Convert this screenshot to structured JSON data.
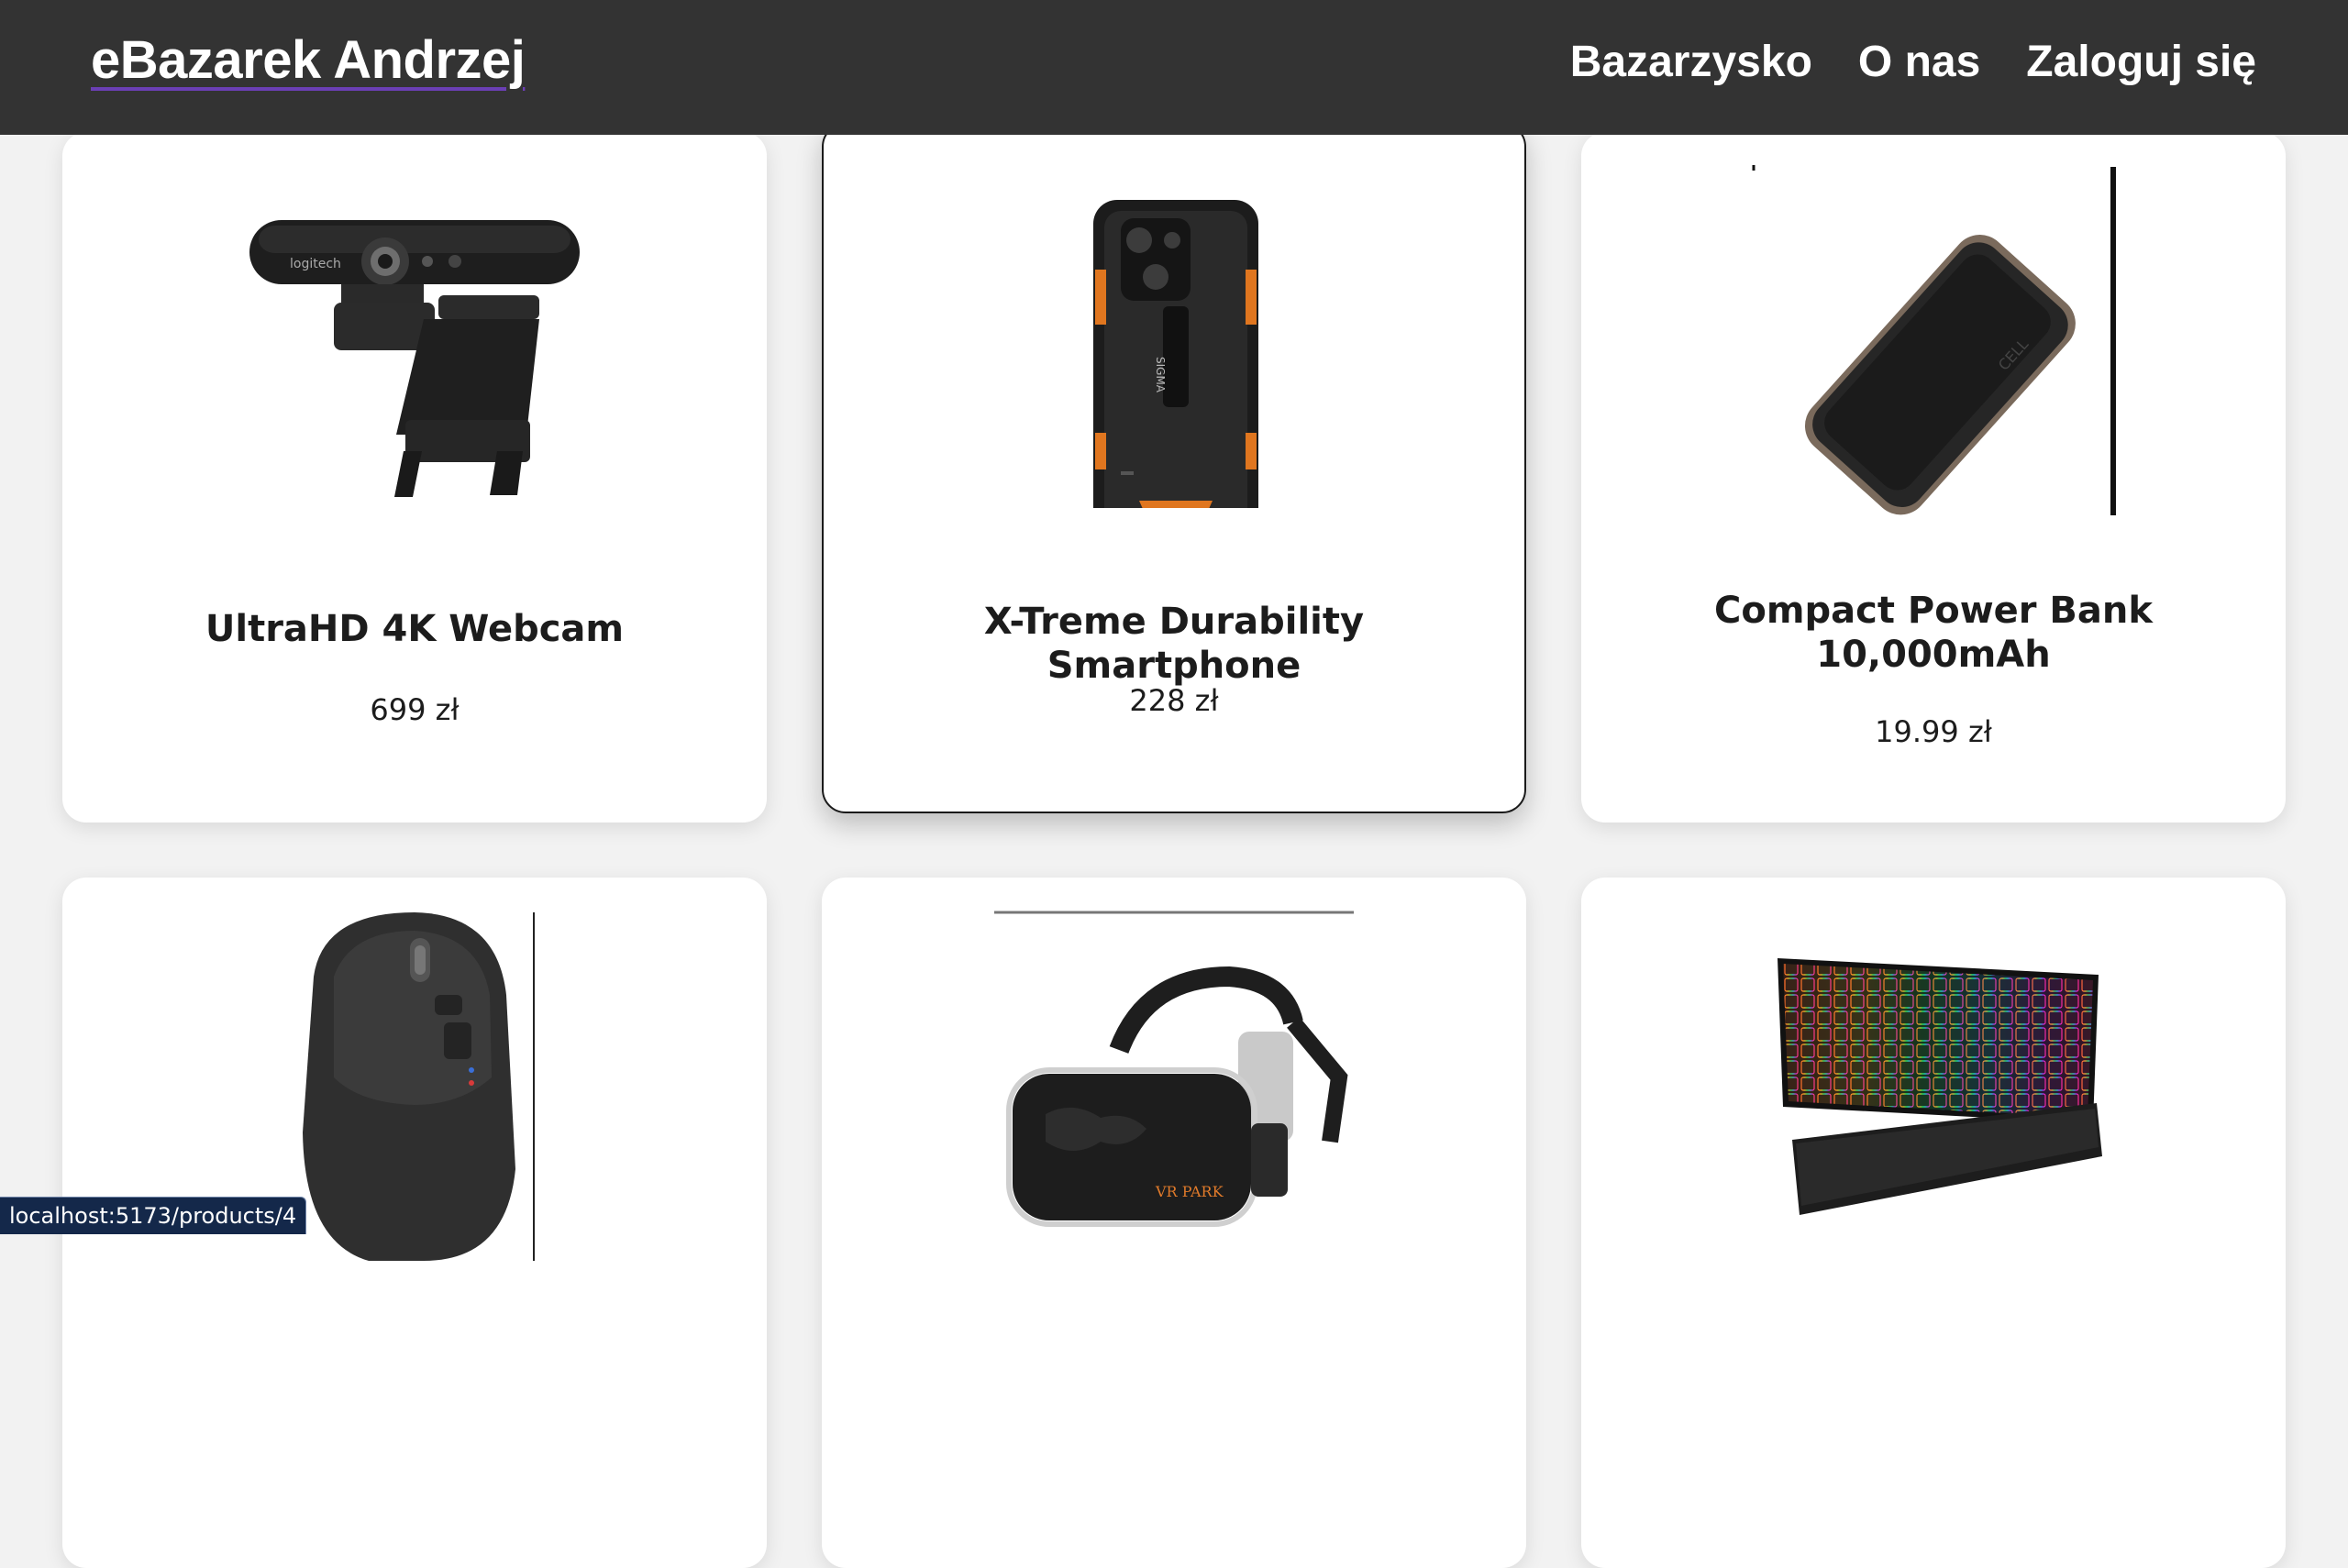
{
  "navbar": {
    "brand": "eBazarek Andrzej",
    "links": [
      "Bazarzysko",
      "O nas",
      "Zaloguj się"
    ],
    "accent_color": "#6b3fb5",
    "background_color": "#333333"
  },
  "products": [
    {
      "title": "UltraHD 4K Webcam",
      "price": "699 zł",
      "image_icon": "webcam-icon"
    },
    {
      "title": "X-Treme Durability Smartphone",
      "price": "228 zł",
      "image_icon": "smartphone-icon"
    },
    {
      "title": "Compact Power Bank 10,000mAh",
      "price": "19.99 zł",
      "image_icon": "power-bank-icon"
    },
    {
      "title": "",
      "price": "",
      "image_icon": "mouse-icon"
    },
    {
      "title": "",
      "price": "",
      "image_icon": "vr-headset-icon"
    },
    {
      "title": "",
      "price": "",
      "image_icon": "keyboard-icon"
    }
  ],
  "status_bar": {
    "url": "localhost:5173/products/4"
  }
}
